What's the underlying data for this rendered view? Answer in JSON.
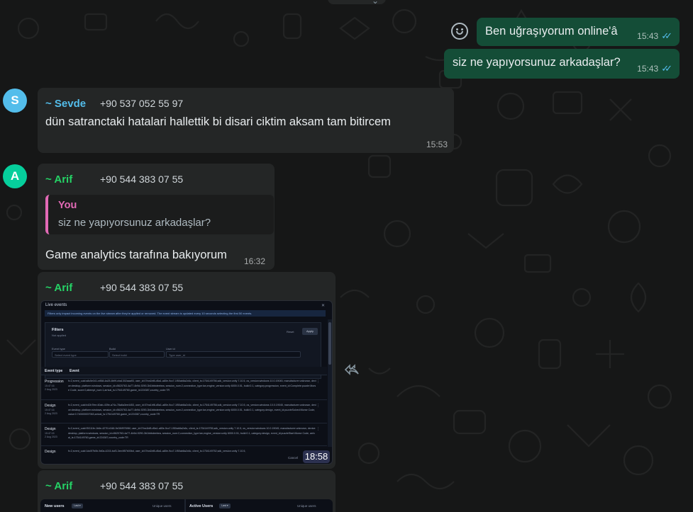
{
  "outgoing": [
    {
      "text": "Ben uğraşıyorum online'â",
      "time": "15:43"
    },
    {
      "text": "siz ne yapıyorsunuz arkadaşlar?",
      "time": "15:43"
    }
  ],
  "sevde_msg": {
    "avatar": "S",
    "avatar_color": "#53bdeb",
    "sender": "~ Sevde",
    "sender_color": "#53bdeb",
    "phone": "+90 537 052 55 97",
    "text": "dün satranctaki hatalari hallettik bi disari ciktim aksam tam bitircem",
    "time": "15:53"
  },
  "arif_msg": {
    "avatar": "A",
    "avatar_color": "#06cf9c",
    "sender": "~ Arif",
    "sender_color": "#25d366",
    "phone": "+90 544 383 07 55",
    "quote_author": "You",
    "quote_text": "siz ne yapıyorsunuz arkadaşlar?",
    "text": "Game analytics tarafına bakıyorum",
    "time": "16:32"
  },
  "arif_image_msg": {
    "sender": "~ Arif",
    "phone": "+90 544 383 07 55",
    "time": "18:58",
    "screenshot": {
      "header": "Live events",
      "info": "Filters only impact incoming events on the live stream after they're applied or removed. The event stream is updated every 10 seconds selecting the first 50 events.",
      "filters_title": "Filters",
      "filters_sub": "Not applied",
      "reset": "Reset",
      "apply": "Apply",
      "fields": [
        {
          "label": "Event type",
          "value": "Select event type"
        },
        {
          "label": "Build",
          "value": "Select build"
        },
        {
          "label": "User id",
          "value": "Type user_id"
        }
      ],
      "columns": [
        "Event type",
        "Event"
      ],
      "rows": [
        {
          "type": "Progression",
          "time": "15:47:16\n2 Aug 2023",
          "event": "fx:2,event_uuid:a8c5e341-e858-4a25-8b9f-cba1302aaa93, user_id:07ea1bf8-d5a1-a80e-9cc7-1f50ab8a2c6c, client_ts:1754149756,sdk_version:unity 7.10.5, os_version:windows 10.0.19045, manufacturer:unknown, device:desktop, platform:windows, session_id:c5620763-4a77-4b9d-9290-3b1bbbdeebea, session_num:2,connection_type:lan,engine_version:unity 6000.0.51, build:0.1, category:progression, event_id:Complete:puzzle:Morse Code, score:0,attempt_num:1,arrival_ts:1754149760,game_id:224387,country_code:TR"
        },
        {
          "type": "Design",
          "time": "15:47:16\n2 Aug 2023",
          "event": "fx:2,event_uuid:b42b7fee-60ab-439e-a74c-78a6a3ee4453, user_id:07ea1bf8-d5a1-a80e-9cc7-1f50ab8a2c6c, client_ts:1754149756,sdk_version:unity 7.10.5, os_version:windows 10.0.19045, manufacturer:unknown, device:desktop, platform:windows, session_id:c5620763-4a77-4b9d-9290-3b1bbbdeebea, session_num:2,connection_type:lan,engine_version:unity 6000.0.51, build:0.1, category:design, event_id:puzzleSolved:Morse Code, value:0.740000007063,arrival_ts:1754149760,game_id:224387,country_code:TR"
        },
        {
          "type": "Design",
          "time": "15:47:15\n2 Aug 2023",
          "event": "fx:2,event_uuid:f3f111fe-1b6e-4270-b348-9e3f4f97696f, user_id:07ea1bf8-d5a1-a80e-9cc7-1f50ab8a2c6c, client_ts:1754149755,sdk_version:unity 7.10.5, os_version:windows 10.0.19045, manufacturer:unknown, device:desktop, platform:windows, session_id:c5620763-4a77-4b9d-9290-3b1bbbdeebea, session_num:2,connection_type:lan,engine_version:unity 6000.0.51, build:0.1, category:design, event_id:puzzleStart:Morse Code, arrival_ts:1754149760,game_id:224387,country_code:TR"
        },
        {
          "type": "Design",
          "time": "",
          "event": "fx:2,event_uuid:1dc0f7b0b-9d0a-4215-bcf3-3ee4f57b00bd, user_id:07ea1bf8-d5a1-a80e-9cc7-1f50ab8a2c6c, client_ts:1754149752,sdk_version:unity 7.10.5,"
        }
      ],
      "cancel": "Cancel"
    }
  },
  "arif_image_msg2": {
    "sender": "~ Arif",
    "phone": "+90 544 383 07 55",
    "screenshot": {
      "left_label": "New users",
      "left_chip": "Last ▾",
      "left_right": "Unique users",
      "right_label": "Active Users",
      "right_chip": "Last ▾",
      "right_right": "Unique users"
    }
  },
  "icons": {
    "emoji": "smiley-icon",
    "forward": "forward-icon",
    "chevron": "chevron-down-icon"
  }
}
